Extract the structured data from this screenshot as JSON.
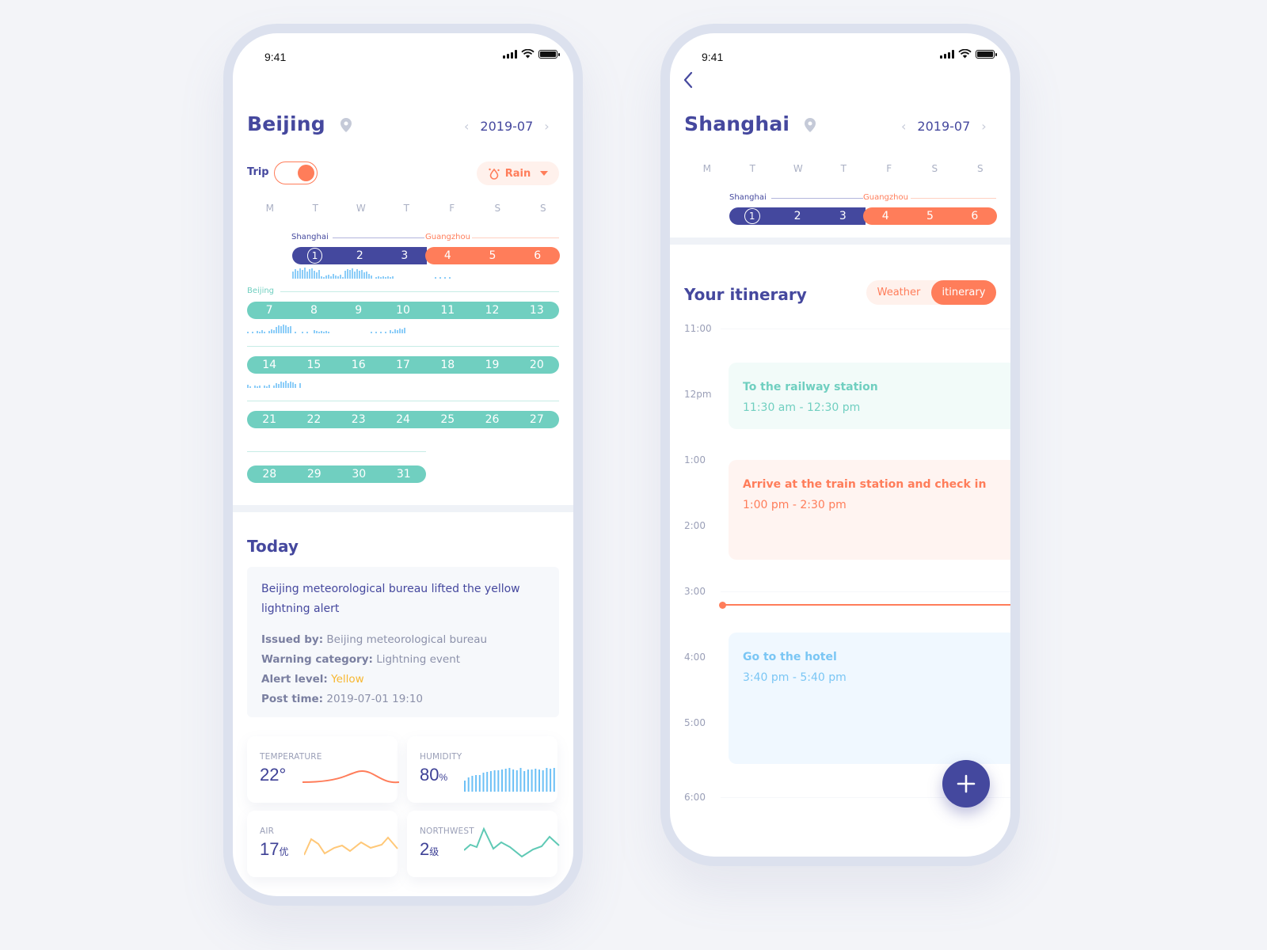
{
  "phone1": {
    "status": {
      "time": "9:41"
    },
    "city": "Beijing",
    "month": "2019-07",
    "trip_label": "Trip",
    "trip_toggle_on": true,
    "weather_filter": "Rain",
    "weekdays": [
      "M",
      "T",
      "W",
      "T",
      "F",
      "S",
      "S"
    ],
    "segments": [
      {
        "label": "Shanghai",
        "color": "#44489e"
      },
      {
        "label": "Guangzhou",
        "color": "#ff7d5a"
      },
      {
        "label": "Beijing",
        "color": "#70cfc0"
      }
    ],
    "week1_shanghai": [
      "1",
      "2",
      "3"
    ],
    "week1_guangzhou": [
      "4",
      "5",
      "6"
    ],
    "week2": [
      "7",
      "8",
      "9",
      "10",
      "11",
      "12",
      "13"
    ],
    "week3": [
      "14",
      "15",
      "16",
      "17",
      "18",
      "19",
      "20"
    ],
    "week4": [
      "21",
      "22",
      "23",
      "24",
      "25",
      "26",
      "27"
    ],
    "week5": [
      "28",
      "29",
      "30",
      "31"
    ],
    "today": {
      "title": "Today",
      "alert_title": "Beijing meteorological bureau lifted the yellow lightning alert",
      "issued_by_label": "Issued by:",
      "issued_by": "Beijing meteorological bureau",
      "category_label": "Warning category:",
      "category": "Lightning event",
      "level_label": "Alert level:",
      "level": "Yellow",
      "post_label": "Post time:",
      "post_time": "2019-07-01  19:10"
    },
    "metrics": {
      "temperature": {
        "label": "TEMPERATURE",
        "value": "22",
        "unit": "°"
      },
      "humidity": {
        "label": "HUMIDITY",
        "value": "80",
        "unit": "%"
      },
      "air": {
        "label": "AIR",
        "value": "17",
        "unit": "优"
      },
      "wind": {
        "label": "NORTHWEST",
        "value": "2",
        "unit": "级"
      }
    }
  },
  "phone2": {
    "status": {
      "time": "9:41"
    },
    "city": "Shanghai",
    "month": "2019-07",
    "weekdays": [
      "M",
      "T",
      "W",
      "T",
      "F",
      "S",
      "S"
    ],
    "segments": [
      {
        "label": "Shanghai"
      },
      {
        "label": "Guangzhou"
      }
    ],
    "week1_shanghai": [
      "1",
      "2",
      "3"
    ],
    "week1_guangzhou": [
      "4",
      "5",
      "6"
    ],
    "itinerary_title": "Your itinerary",
    "tabs": [
      {
        "label": "Weather",
        "active": false
      },
      {
        "label": "itinerary",
        "active": true
      }
    ],
    "hours": [
      "11:00",
      "12pm",
      "1:00",
      "2:00",
      "3:00",
      "4:00",
      "5:00",
      "6:00"
    ],
    "events": [
      {
        "title": "To the railway station",
        "time": "11:30 am - 12:30 pm"
      },
      {
        "title": "Arrive at the train station and check in",
        "time": "1:00 pm - 2:30 pm"
      },
      {
        "title": "Go to the hotel",
        "time": "3:40 pm - 5:40 pm"
      }
    ]
  }
}
